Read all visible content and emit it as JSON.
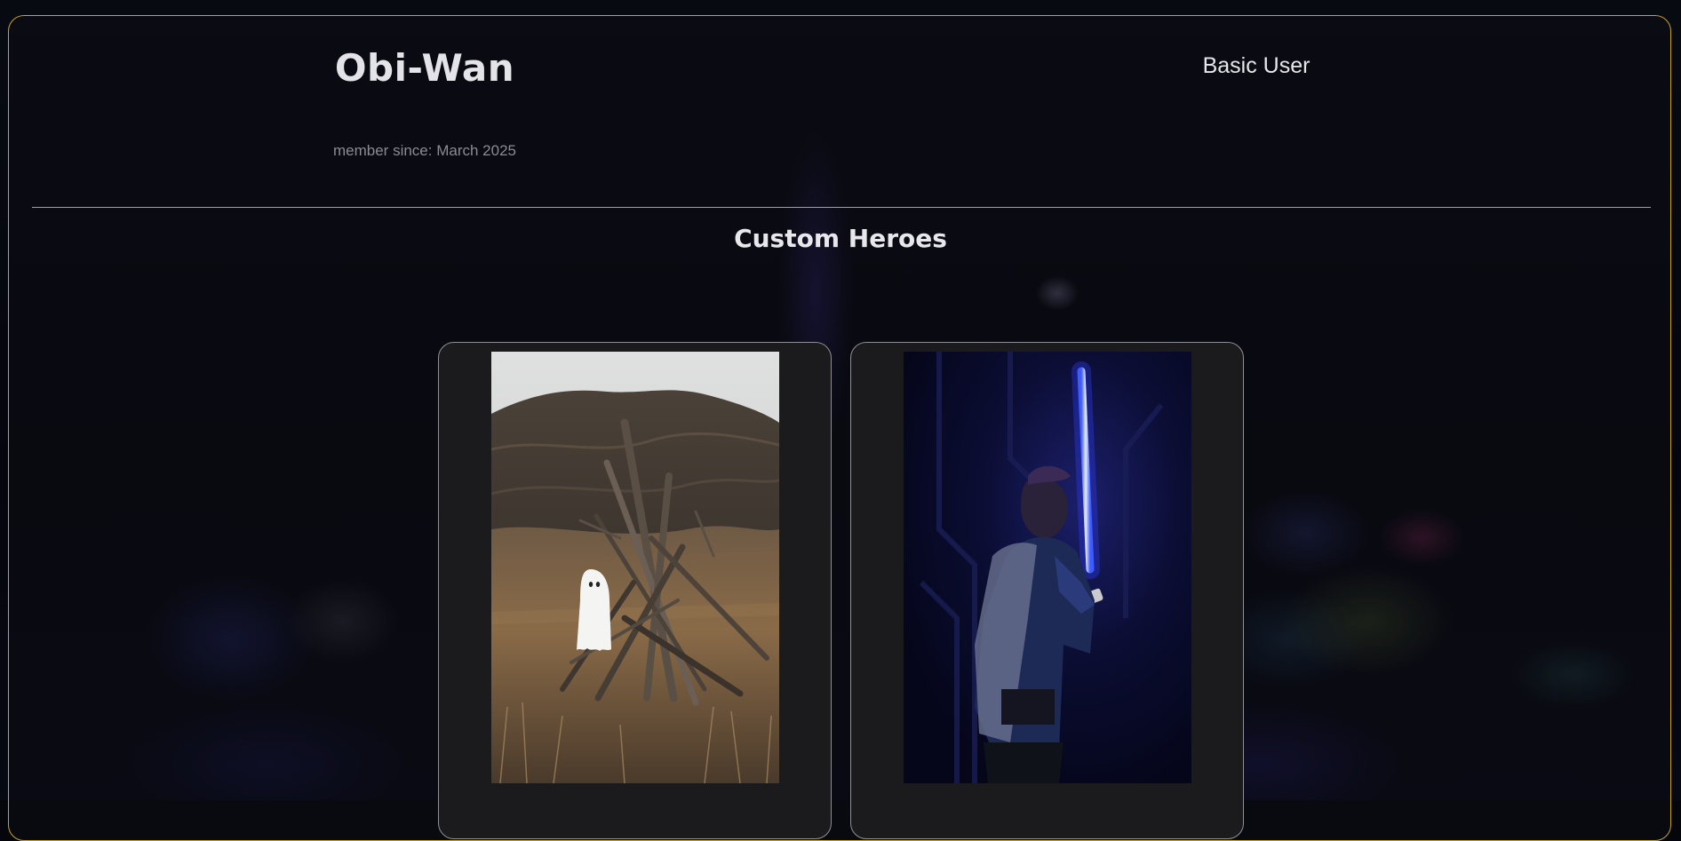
{
  "profile": {
    "username": "Obi-Wan",
    "role": "Basic User",
    "member_since": "member since: March 2025"
  },
  "section": {
    "title": "Custom Heroes"
  },
  "heroes": [
    {
      "image": "ghost-teepee-hero-image",
      "accent": "#8a6a45"
    },
    {
      "image": "lightsaber-hero-image",
      "accent": "#3b4bff"
    }
  ],
  "theme": {
    "accent": "#c9a227",
    "card_bg": "#1b1b1d",
    "text": "#e4e4e8",
    "muted_text": "#8a8b93"
  }
}
